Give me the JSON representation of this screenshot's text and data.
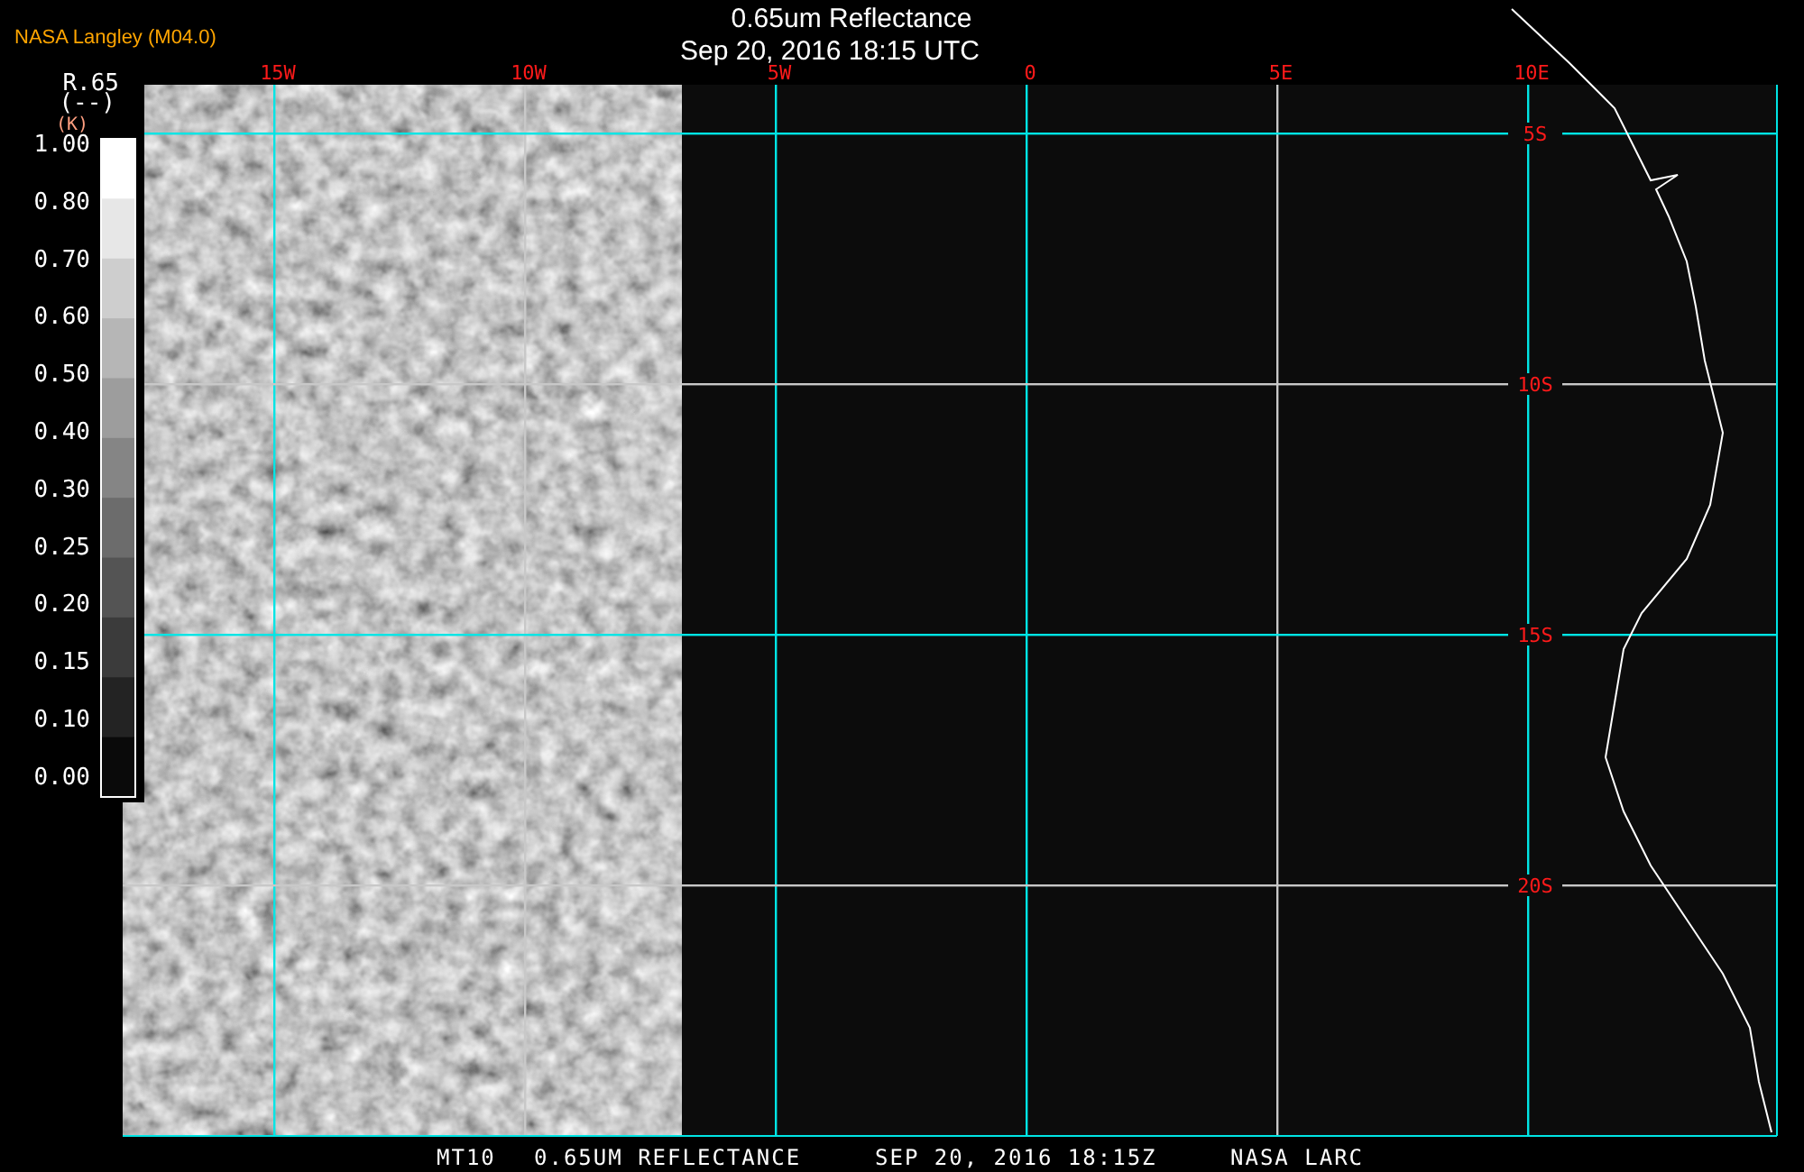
{
  "header": {
    "source": "NASA Langley (M04.0)",
    "title": "0.65um Reflectance",
    "datetime": "Sep 20, 2016 18:15 UTC"
  },
  "legend": {
    "variable": "R.65",
    "units": "(--)",
    "alt_units": "(K)",
    "ticks": [
      "1.00",
      "0.80",
      "0.70",
      "0.60",
      "0.50",
      "0.40",
      "0.30",
      "0.25",
      "0.20",
      "0.15",
      "0.10",
      "0.00"
    ]
  },
  "map": {
    "longitude_lines": [
      {
        "label": "15W",
        "color": "#00e5e5"
      },
      {
        "label": "10W",
        "color": "#c8c8c8"
      },
      {
        "label": "5W",
        "color": "#00e5e5"
      },
      {
        "label": "0",
        "color": "#00e5e5"
      },
      {
        "label": "5E",
        "color": "#c8c8c8"
      },
      {
        "label": "10E",
        "color": "#00e5e5"
      }
    ],
    "latitude_lines": [
      {
        "label": "5S",
        "color": "#00e5e5"
      },
      {
        "label": "10S",
        "color": "#c8c8c8"
      },
      {
        "label": "15S",
        "color": "#00e5e5"
      },
      {
        "label": "20S",
        "color": "#c8c8c8"
      }
    ]
  },
  "footer": [
    "MT10",
    "0.65UM REFLECTANCE",
    "SEP 20, 2016 18:15Z",
    "NASA LARC"
  ]
}
